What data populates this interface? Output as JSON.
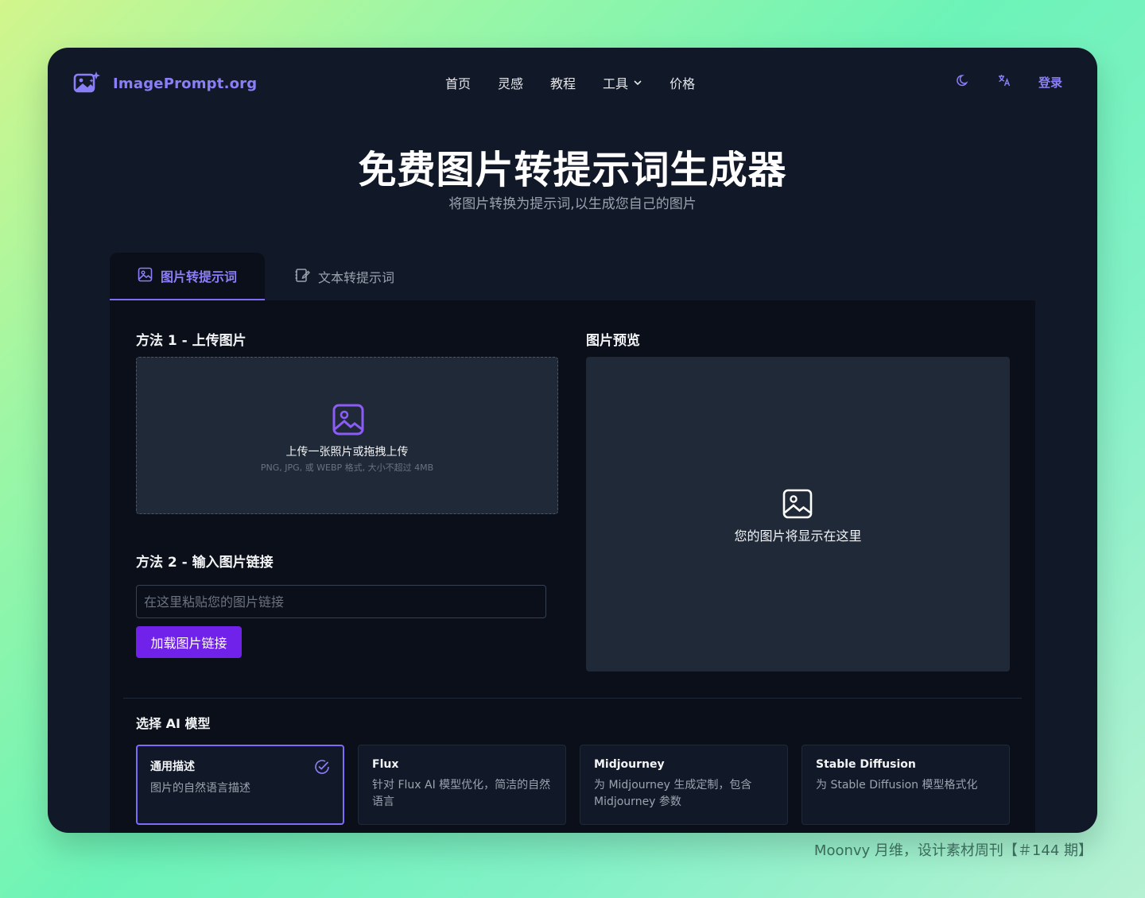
{
  "brand": {
    "name": "ImagePrompt.org",
    "accent": "#8b7ff8"
  },
  "nav": {
    "items": [
      {
        "label": "首页"
      },
      {
        "label": "灵感"
      },
      {
        "label": "教程"
      },
      {
        "label": "工具"
      },
      {
        "label": "价格"
      }
    ],
    "login": "登录"
  },
  "hero": {
    "title": "免费图片转提示词生成器",
    "subtitle": "将图片转换为提示词,以生成您自己的图片"
  },
  "tabs": [
    {
      "label": "图片转提示词",
      "active": true,
      "icon": "image-icon"
    },
    {
      "label": "文本转提示词",
      "active": false,
      "icon": "edit-icon"
    }
  ],
  "method1": {
    "label": "方法 1 - 上传图片",
    "upload_text": "上传一张照片或拖拽上传",
    "upload_hint": "PNG, JPG, 或 WEBP 格式, 大小不超过 4MB"
  },
  "method2": {
    "label": "方法 2 - 输入图片链接",
    "placeholder": "在这里粘贴您的图片链接",
    "value": "",
    "button": "加载图片链接"
  },
  "preview": {
    "label": "图片预览",
    "empty_text": "您的图片将显示在这里"
  },
  "models": {
    "label": "选择 AI 模型",
    "items": [
      {
        "title": "通用描述",
        "desc": "图片的自然语言描述",
        "selected": true
      },
      {
        "title": "Flux",
        "desc": "针对 Flux AI 模型优化，简洁的自然语言",
        "selected": false
      },
      {
        "title": "Midjourney",
        "desc": "为 Midjourney 生成定制，包含 Midjourney 参数",
        "selected": false
      },
      {
        "title": "Stable Diffusion",
        "desc": "为 Stable Diffusion 模型格式化",
        "selected": false
      }
    ]
  },
  "footer_note": "Moonvy 月维，设计素材周刊【＃144 期】",
  "colors": {
    "frame_bg": "#111827",
    "panel_bg": "#0b0f19",
    "box_bg": "#1f2937",
    "button": "#7122ea"
  }
}
